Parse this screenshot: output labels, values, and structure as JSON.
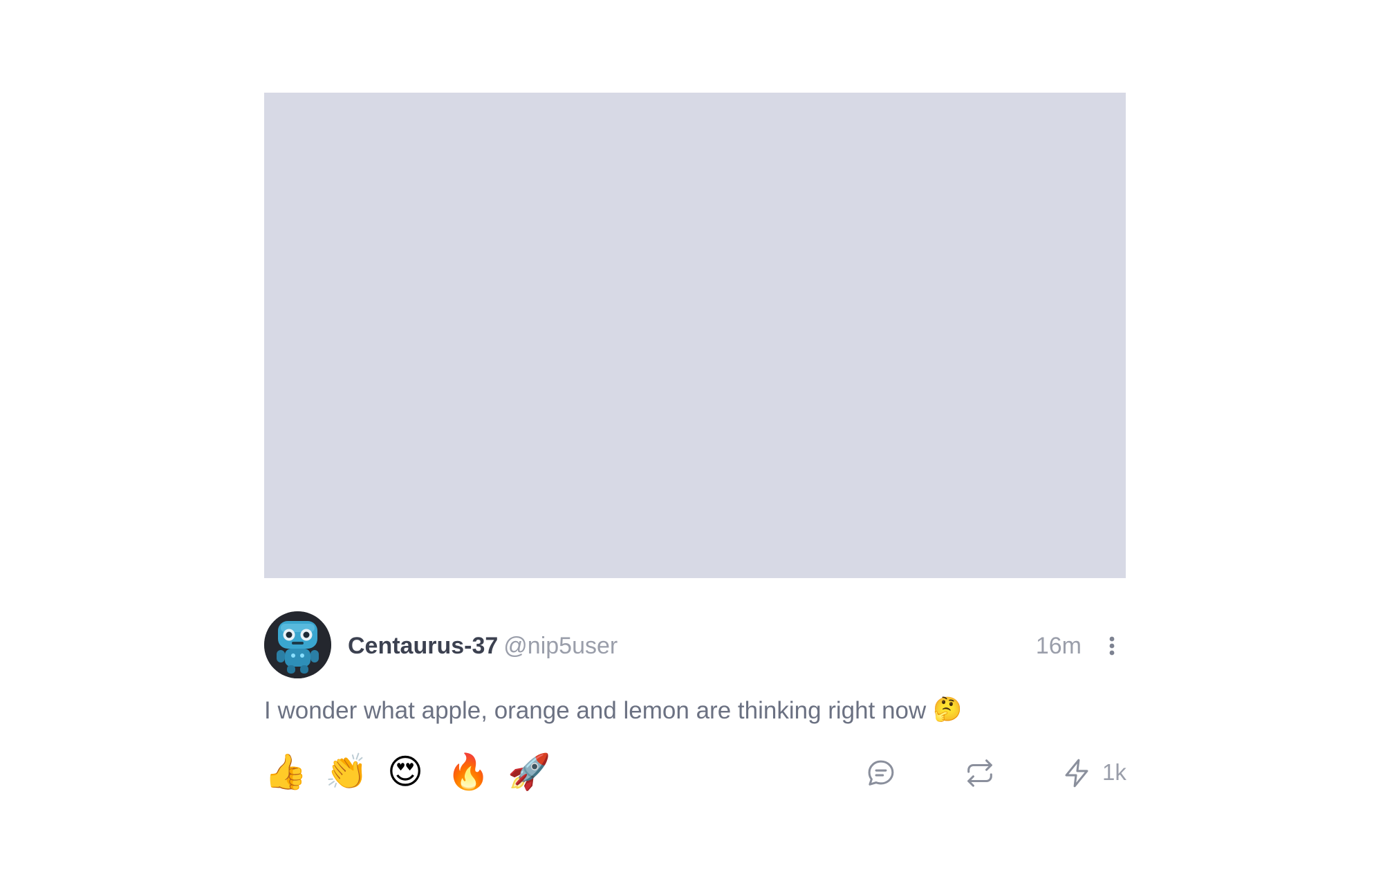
{
  "post": {
    "author": {
      "display_name": "Centaurus-37",
      "handle": "@nip5user",
      "avatar_icon": "robot-avatar"
    },
    "timestamp": "16m",
    "content": {
      "text": "I wonder what apple, orange and lemon are thinking right now",
      "emoji": "🤔"
    },
    "media": {
      "placeholder_color": "#d7d9e5"
    },
    "reactions": [
      {
        "emoji": "👍",
        "name": "thumbs-up"
      },
      {
        "emoji": "👏",
        "name": "clapping-hands"
      },
      {
        "emoji": "😍",
        "name": "heart-eyes"
      },
      {
        "emoji": "🔥",
        "name": "fire"
      },
      {
        "emoji": "🚀",
        "name": "rocket"
      }
    ],
    "actions": {
      "reply_icon": "comment-icon",
      "repost_icon": "repost-icon",
      "zap_icon": "lightning-icon",
      "zap_count": "1k"
    }
  },
  "colors": {
    "text_primary": "#3c4150",
    "text_secondary": "#9a9eaa",
    "body_text": "#6b7182"
  }
}
